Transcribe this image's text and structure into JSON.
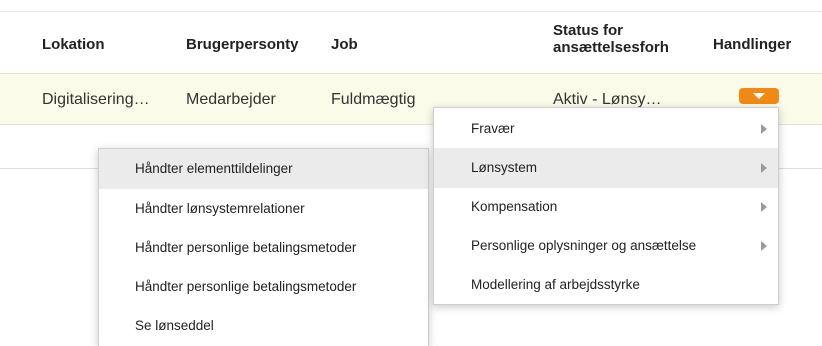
{
  "table": {
    "headers": {
      "lokation": "Lokation",
      "brugerpersontype": "Brugerpersonty",
      "job": "Job",
      "status_line1": "Status for",
      "status_line2": "ansættelsesforh",
      "handlinger": "Handlinger"
    },
    "row": {
      "lokation": "Digitalisering…",
      "brugerpersontype": "Medarbejder",
      "job": "Fuldmægtig",
      "status": "Aktiv - Lønsy…"
    },
    "action_button": {
      "icon": "caret-down-icon",
      "color": "#f08a14"
    }
  },
  "menu": {
    "items": [
      {
        "label": "Fravær",
        "has_submenu": true
      },
      {
        "label": "Lønsystem",
        "has_submenu": true,
        "active": true
      },
      {
        "label": "Kompensation",
        "has_submenu": true
      },
      {
        "label": "Personlige oplysninger og ansættelse",
        "has_submenu": true
      },
      {
        "label": "Modellering af arbejdsstyrke",
        "has_submenu": false
      }
    ]
  },
  "submenu": {
    "items": [
      {
        "label": "Håndter elementtildelinger",
        "active": true
      },
      {
        "label": "Håndter lønsystemrelationer"
      },
      {
        "label": "Håndter personlige betalingsmetoder"
      },
      {
        "label": "Håndter personlige betalingsmetoder"
      },
      {
        "label": "Se lønseddel"
      }
    ]
  },
  "colors": {
    "row_highlight": "#fbfbe9",
    "menu_active": "#ebebeb",
    "accent": "#f08a14"
  }
}
